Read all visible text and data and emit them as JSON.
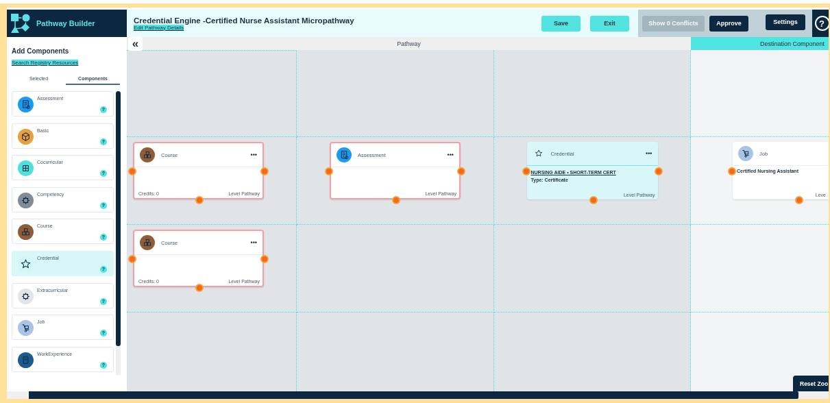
{
  "app": {
    "name": "Pathway Builder"
  },
  "header": {
    "title": "Credential Engine -Certified Nurse Assistant Micropathway",
    "link": "Edit Pathway Details",
    "help": "?",
    "buttons": [
      {
        "label": "Save",
        "kind": "primary",
        "disabled": false
      },
      {
        "label": "Exit",
        "kind": "primary",
        "disabled": false
      },
      {
        "label": "Show 0 Conflicts",
        "kind": "review",
        "disabled": true
      },
      {
        "label": "Approve",
        "kind": "review",
        "disabled": false
      },
      {
        "label": "Settings",
        "kind": "settings",
        "disabled": false
      }
    ]
  },
  "sidebar": {
    "heading": "Add Components",
    "link": "Search Registry Resources",
    "tabs": [
      {
        "label": "Selected",
        "selected": false
      },
      {
        "label": "Components",
        "selected": true
      }
    ],
    "items": [
      {
        "label": "Assessment",
        "kind": "assessment",
        "color": "#1a9bf0",
        "selected": false,
        "help": "?"
      },
      {
        "label": "Basic",
        "kind": "basic",
        "color": "#eba03f",
        "selected": false,
        "help": "?"
      },
      {
        "label": "Cocurricular",
        "kind": "cocurricular",
        "color": "#4fe0db",
        "selected": false,
        "help": "?"
      },
      {
        "label": "Competency",
        "kind": "competency",
        "color": "#808d99",
        "selected": false,
        "help": "?"
      },
      {
        "label": "Course",
        "kind": "course",
        "color": "#8e5e3a",
        "selected": false,
        "help": "?"
      },
      {
        "label": "Credential",
        "kind": "credential",
        "color": "#d2f5f6",
        "selected": true,
        "help": "?"
      },
      {
        "label": "Extracurricular",
        "kind": "extracurricular",
        "color": "#e2e4e7",
        "selected": false,
        "help": "?"
      },
      {
        "label": "Job",
        "kind": "job",
        "color": "#a9c4e4",
        "selected": false,
        "help": "?"
      },
      {
        "label": "WorkExperience",
        "kind": "workexperience",
        "color": "#1d5b8f",
        "selected": false,
        "help": "?"
      }
    ]
  },
  "canvas": {
    "collapse": "«",
    "reset_zoom": "Reset Zoo",
    "header": {
      "pathway": "Pathway",
      "destination": "Destination Component"
    },
    "rows": [
      {
        "cells": [
          {
            "kind": "empty"
          },
          {
            "kind": "empty"
          },
          {
            "kind": "empty"
          },
          {
            "kind": "empty"
          }
        ]
      },
      {
        "cells": [
          {
            "kind": "card",
            "card": {
              "kind": "course",
              "color": "#8e5e3a",
              "title": "Course",
              "menu": "•••",
              "flagged": true,
              "highlighted": false,
              "credits": "Credits: 0",
              "footer": "Level Pathway"
            }
          },
          {
            "kind": "card",
            "card": {
              "kind": "assessment",
              "color": "#1a9bf0",
              "title": "Assessment",
              "menu": "•••",
              "flagged": true,
              "highlighted": false,
              "footer": "Level Pathway"
            }
          },
          {
            "kind": "card",
            "card": {
              "kind": "credential",
              "title": "Credential",
              "menu": "•••",
              "flagged": false,
              "highlighted": true,
              "lines": [
                {
                  "text": "NURSING AIDE • SHORT-TERM CERT",
                  "kind": "link"
                },
                {
                  "text": "Type: Certificate",
                  "kind": "bold"
                }
              ],
              "footer": "Level Pathway"
            }
          },
          {
            "kind": "card",
            "card": {
              "kind": "job",
              "color": "#a9c4e4",
              "title": "Job",
              "flagged": false,
              "highlighted": false,
              "lines": [
                {
                  "text": "Certified Nursing Assistant",
                  "kind": "bold"
                }
              ],
              "footer": "Leve"
            }
          }
        ]
      },
      {
        "cells": [
          {
            "kind": "card",
            "card": {
              "kind": "course",
              "color": "#8e5e3a",
              "title": "Course",
              "menu": "•••",
              "flagged": true,
              "highlighted": false,
              "credits": "Credits: 0",
              "footer": "Level Pathway"
            }
          },
          {
            "kind": "empty"
          },
          {
            "kind": "empty"
          },
          {
            "kind": "empty"
          }
        ]
      },
      {
        "cells": [
          {
            "kind": "empty"
          },
          {
            "kind": "empty"
          },
          {
            "kind": "empty"
          },
          {
            "kind": "empty"
          }
        ]
      }
    ]
  }
}
